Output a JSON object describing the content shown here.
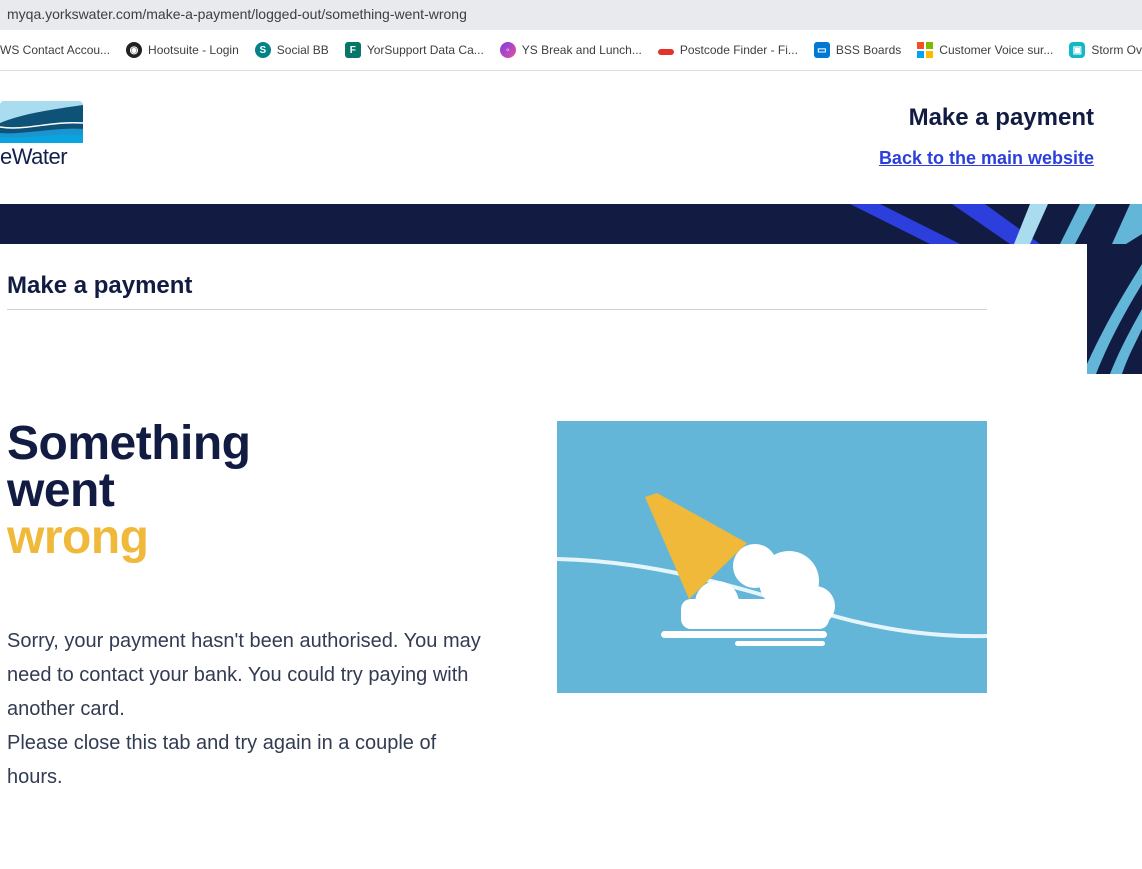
{
  "browser": {
    "url": "myqa.yorkswater.com/make-a-payment/logged-out/something-went-wrong",
    "bookmarks": [
      {
        "label": "WS Contact Accou...",
        "icon": "none",
        "color": ""
      },
      {
        "label": "Hootsuite - Login",
        "icon": "owl-icon",
        "color": "#222222"
      },
      {
        "label": "Social BB",
        "icon": "sharepoint-icon",
        "color": "#038387"
      },
      {
        "label": "YorSupport Data Ca...",
        "icon": "forms-icon",
        "color": "#077568"
      },
      {
        "label": "YS Break and Lunch...",
        "icon": "loop-icon",
        "color": "#7b3fe4"
      },
      {
        "label": "Postcode Finder - Fi...",
        "icon": "royal-mail-icon",
        "color": "#e4322b"
      },
      {
        "label": "BSS Boards",
        "icon": "azure-devops-icon",
        "color": "#0078d4"
      },
      {
        "label": "Customer Voice sur...",
        "icon": "microsoft-icon",
        "color": "#f25022"
      },
      {
        "label": "Storm Overflow",
        "icon": "storm-icon",
        "color": "#14b8c4"
      }
    ]
  },
  "header": {
    "logo_text": "eWater",
    "title": "Make a payment",
    "back_link": "Back to the main website"
  },
  "main": {
    "section_title": "Make a payment",
    "heading": {
      "line1": "Something",
      "line2": "went",
      "line3": "wrong"
    },
    "message_line1": "Sorry, your payment hasn't been authorised. You may need to contact your bank. You could try paying with another card.",
    "message_line2": "Please close this tab and try again in a couple of hours."
  },
  "colors": {
    "navy": "#121c43",
    "accent_yellow": "#f0b93a",
    "link_blue": "#2c3fdc",
    "sky_blue": "#63b6d7"
  }
}
